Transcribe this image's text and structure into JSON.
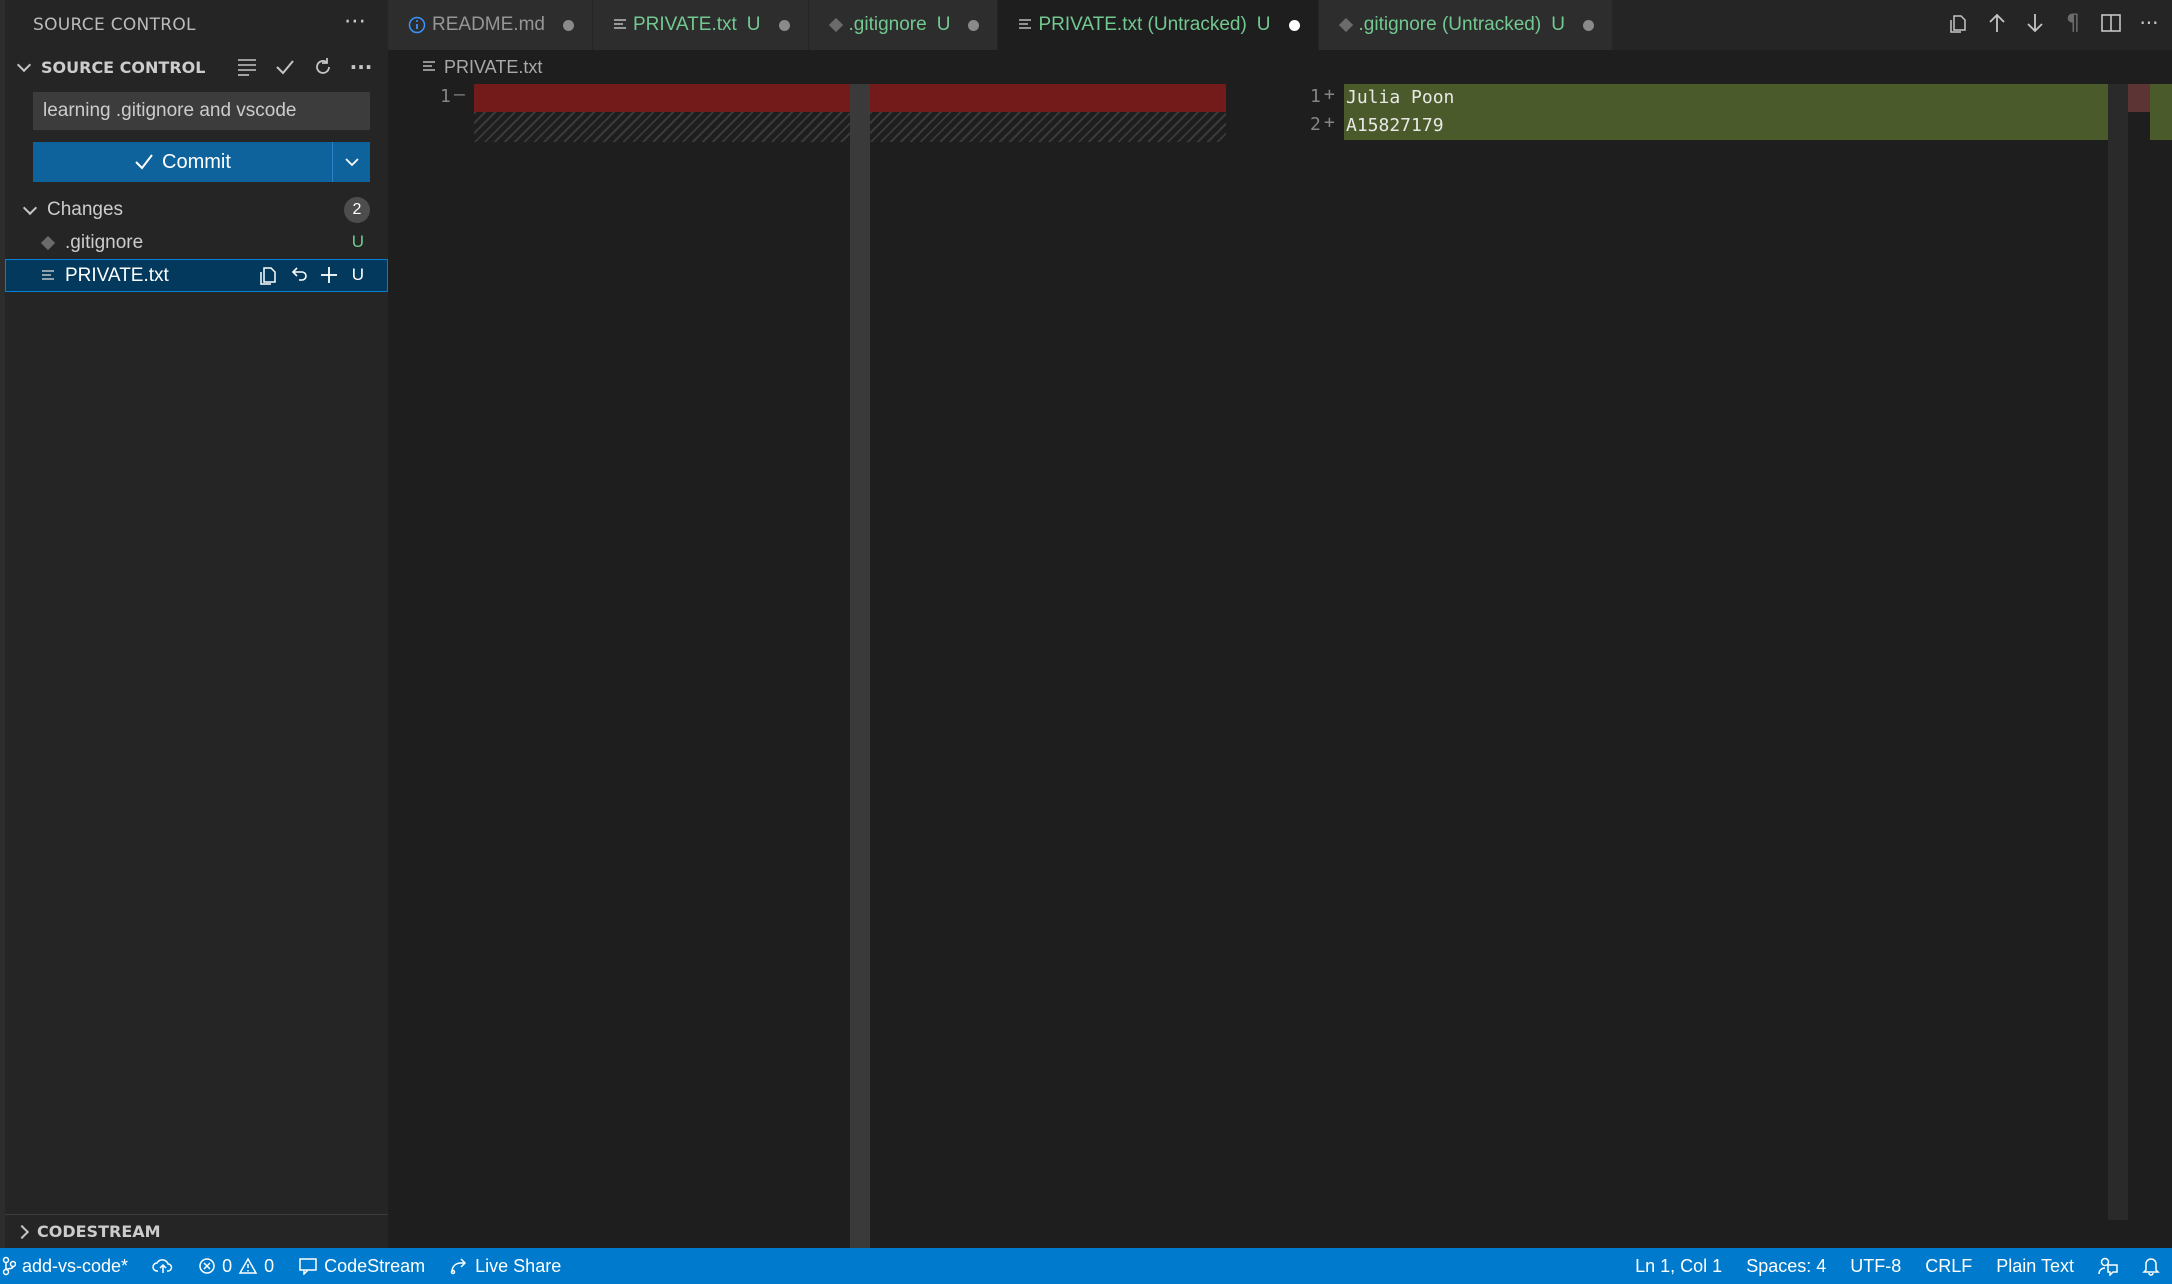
{
  "sidebar": {
    "view_title": "SOURCE CONTROL",
    "section_title": "SOURCE CONTROL",
    "commit_message": "learning .gitignore and vscode",
    "commit_label": "Commit",
    "changes_label": "Changes",
    "changes_count": "2",
    "files": [
      {
        "name": ".gitignore",
        "status": "U"
      },
      {
        "name": "PRIVATE.txt",
        "status": "U"
      }
    ],
    "collapsed_section": "CODESTREAM"
  },
  "tabs": [
    {
      "name": "README.md",
      "status": ""
    },
    {
      "name": "PRIVATE.txt",
      "status": "U"
    },
    {
      "name": ".gitignore",
      "status": "U"
    },
    {
      "name": "PRIVATE.txt (Untracked)",
      "status": "U"
    },
    {
      "name": ".gitignore (Untracked)",
      "status": "U"
    }
  ],
  "breadcrumb": "PRIVATE.txt",
  "diff": {
    "left": [
      {
        "num": "1",
        "marker": "—"
      }
    ],
    "right": [
      {
        "num": "1",
        "marker": "+",
        "text": "Julia Poon"
      },
      {
        "num": "2",
        "marker": "+",
        "text": "A15827179"
      }
    ]
  },
  "statusbar": {
    "branch": "add-vs-code*",
    "errors": "0",
    "warnings": "0",
    "codestream": "CodeStream",
    "liveshare": "Live Share",
    "position": "Ln 1, Col 1",
    "spaces": "Spaces: 4",
    "encoding": "UTF-8",
    "eol": "CRLF",
    "language": "Plain Text"
  },
  "colors": {
    "accent": "#007acc",
    "commit_button": "#0e639c",
    "deleted_line": "#731a1a",
    "inserted_line": "#4b5a2a",
    "untracked": "#73c991"
  }
}
